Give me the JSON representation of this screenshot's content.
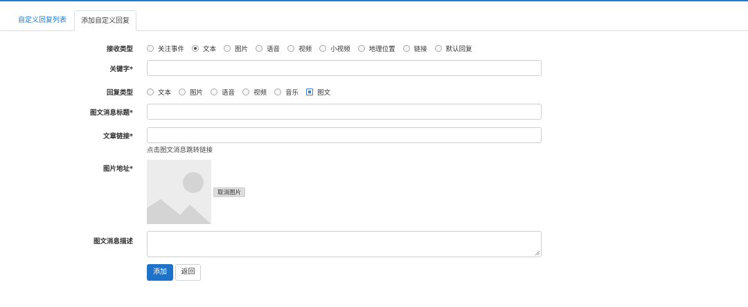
{
  "tabs": [
    {
      "label": "自定义回复列表"
    },
    {
      "label": "添加自定义回复"
    }
  ],
  "form": {
    "receive_type": {
      "label": "接收类型",
      "options": [
        "关注事件",
        "文本",
        "图片",
        "语音",
        "视频",
        "小视频",
        "地理位置",
        "链接",
        "默认回复"
      ],
      "selected": "文本"
    },
    "keyword": {
      "label": "关键字*",
      "value": ""
    },
    "reply_type": {
      "label": "回复类型",
      "options": [
        "文本",
        "图片",
        "语音",
        "视频",
        "音乐",
        "图文"
      ],
      "selected": "图文"
    },
    "news_title": {
      "label": "图文消息标题*",
      "value": ""
    },
    "article_link": {
      "label": "文章链接*",
      "value": "",
      "help": "点击图文消息跳转链接"
    },
    "image_url": {
      "label": "图片地址*",
      "cancel_label": "取消图片"
    },
    "news_desc": {
      "label": "图文消息描述",
      "value": ""
    },
    "buttons": {
      "submit": "添加",
      "back": "返回"
    }
  },
  "colors": {
    "accent": "#1e73c8",
    "tab_active": "#1f7ad2"
  }
}
